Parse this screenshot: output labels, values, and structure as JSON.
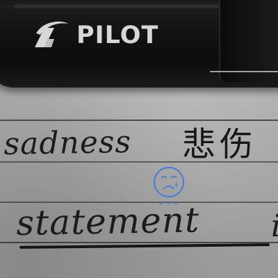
{
  "brand": {
    "logo_text": "PILOT"
  },
  "notes": {
    "word1": "sadness",
    "word1_chinese": "悲伤",
    "word2": "statement",
    "word2_tail": "i"
  },
  "doodle": {
    "icon": "crying-face-icon",
    "tear_marks": "ᵟᵟᵟ"
  },
  "colors": {
    "marker_body": "#121212",
    "brand_text": "#d7d7d7",
    "paper": "#a8a8a8",
    "ink_black": "#1b1b1b",
    "ink_blue": "#4a7fd6"
  }
}
